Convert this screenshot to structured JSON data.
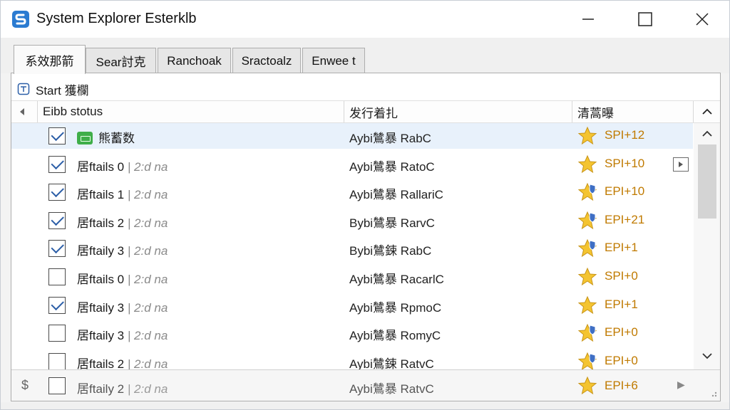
{
  "window": {
    "title": "System Explorer Esterklb",
    "accent": "#2b7bd1"
  },
  "tabs": [
    {
      "label": "系效那箭",
      "active": true
    },
    {
      "label": "Sear討克",
      "active": false
    },
    {
      "label": "Ranchoak",
      "active": false
    },
    {
      "label": "Sractoalz",
      "active": false
    },
    {
      "label": "Enwee t",
      "active": false
    }
  ],
  "start": {
    "label": "Start 獲欄",
    "icon": "tag-icon"
  },
  "columns": {
    "col1": "Eibb stotus",
    "col2": "发行着扎",
    "col3": "清蒿曝"
  },
  "rows": [
    {
      "checked": true,
      "name": "熊蓄数",
      "sub": "",
      "has_icon": true,
      "publisher": "Aybi鷥暴 RabC",
      "rating": "SPI+12",
      "star": "gold",
      "selected": true,
      "expand": false
    },
    {
      "checked": true,
      "name": "居ftails 0",
      "sub": "| 2:d na",
      "has_icon": false,
      "publisher": "Aybi鷥暴 RatoC",
      "rating": "SPI+10",
      "star": "gold",
      "selected": false,
      "expand": true
    },
    {
      "checked": true,
      "name": "居ftails 1",
      "sub": "| 2:d na",
      "has_icon": false,
      "publisher": "Aybi鷥暴 RallariC",
      "rating": "EPI+10",
      "star": "badge",
      "selected": false,
      "expand": false
    },
    {
      "checked": true,
      "name": "居ftails 2",
      "sub": "| 2:d na",
      "has_icon": false,
      "publisher": "Bybi鷥暴 RarvC",
      "rating": "EPI+21",
      "star": "badge",
      "selected": false,
      "expand": false
    },
    {
      "checked": true,
      "name": "居ftaily 3",
      "sub": "| 2:d na",
      "has_icon": false,
      "publisher": "Bybi鷥鋉 RabC",
      "rating": "EPI+1",
      "star": "badge",
      "selected": false,
      "expand": false
    },
    {
      "checked": false,
      "name": "居ftails 0",
      "sub": "| 2:d na",
      "has_icon": false,
      "publisher": "Aybi鷥暴 RacarlC",
      "rating": "SPI+0",
      "star": "gold",
      "selected": false,
      "expand": false
    },
    {
      "checked": true,
      "name": "居ftaily 3",
      "sub": "| 2:d na",
      "has_icon": false,
      "publisher": "Aybi鷥暴 RpmoC",
      "rating": "EPI+1",
      "star": "gold",
      "selected": false,
      "expand": false
    },
    {
      "checked": false,
      "name": "居ftaily 3",
      "sub": "| 2:d na",
      "has_icon": false,
      "publisher": "Aybi鷥暴 RomyC",
      "rating": "EPI+0",
      "star": "badge",
      "selected": false,
      "expand": false
    },
    {
      "checked": false,
      "name": "居ftails 2",
      "sub": "| 2:d na",
      "has_icon": false,
      "publisher": "Aybi鷥鋉 RatvC",
      "rating": "EPI+0",
      "star": "badge",
      "selected": false,
      "expand": false
    }
  ],
  "footer": {
    "symbol": "$",
    "checked": false,
    "name": "居ftaily 2",
    "sub": "| 2:d na",
    "publisher": "Aybi鷥暴 RatvC",
    "rating": "EPI+6"
  }
}
